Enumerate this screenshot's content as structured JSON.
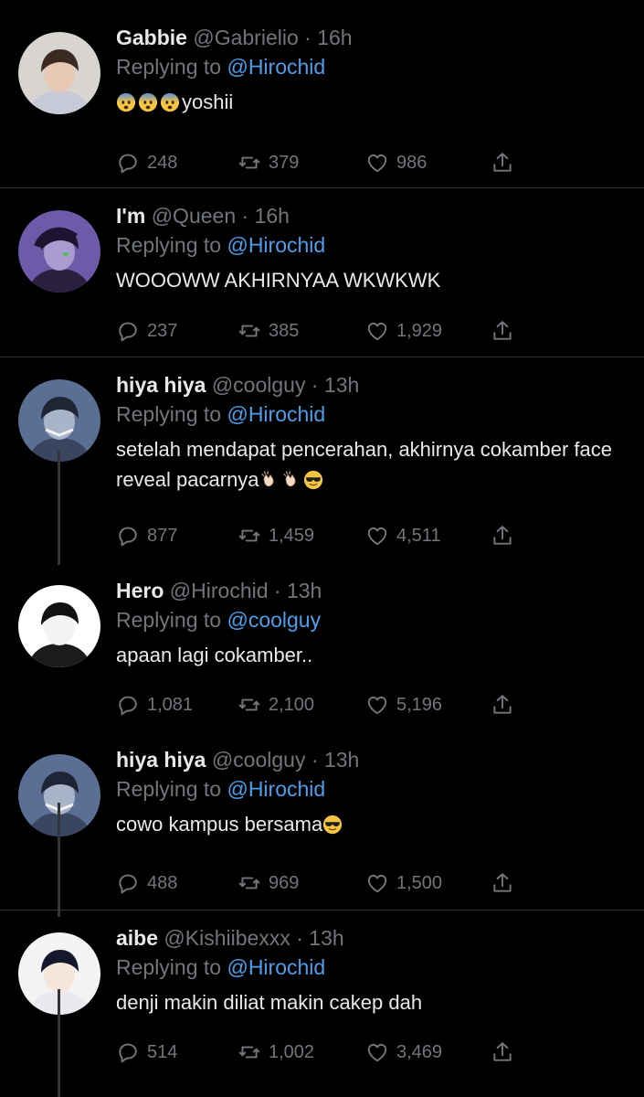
{
  "tweets": [
    {
      "name": "Gabbie",
      "handle": "@Gabrielio",
      "time": "16h",
      "replying_prefix": "Replying to ",
      "replying_to": "@Hirochid",
      "text": "yoshii",
      "emojis": [
        "fearful",
        "fearful",
        "fearful"
      ],
      "emoji_pos": "before",
      "replies": "248",
      "retweets": "379",
      "likes": "986"
    },
    {
      "name": "I'm",
      "handle": "@Queen",
      "time": "16h",
      "replying_prefix": "Replying to ",
      "replying_to": "@Hirochid",
      "text": "WOOOWW AKHIRNYAA WKWKWK",
      "emojis": [],
      "emoji_pos": "after",
      "replies": "237",
      "retweets": "385",
      "likes": "1,929"
    },
    {
      "name": "hiya hiya",
      "handle": "@coolguy",
      "time": "13h",
      "replying_prefix": "Replying to ",
      "replying_to": "@Hirochid",
      "text": "setelah mendapat pencerahan, akhirnya cokamber face reveal pacarnya",
      "emojis": [
        "clap",
        "clap",
        "sunglasses"
      ],
      "emoji_pos": "after",
      "replies": "877",
      "retweets": "1,459",
      "likes": "4,511"
    },
    {
      "name": "Hero",
      "handle": "@Hirochid",
      "time": "13h",
      "replying_prefix": "Replying to ",
      "replying_to": "@coolguy",
      "text": "apaan lagi cokamber..",
      "emojis": [],
      "emoji_pos": "after",
      "replies": "1,081",
      "retweets": "2,100",
      "likes": "5,196"
    },
    {
      "name": "hiya hiya",
      "handle": "@coolguy",
      "time": "13h",
      "replying_prefix": "Replying to ",
      "replying_to": "@Hirochid",
      "text": "cowo kampus bersama",
      "emojis": [
        "sunglasses"
      ],
      "emoji_pos": "after",
      "replies": "488",
      "retweets": "969",
      "likes": "1,500"
    },
    {
      "name": "aibe",
      "handle": "@Kishiibexxx",
      "time": "13h",
      "replying_prefix": "Replying to ",
      "replying_to": "@Hirochid",
      "text": "denji makin diliat makin cakep dah",
      "emojis": [],
      "emoji_pos": "after",
      "replies": "514",
      "retweets": "1,002",
      "likes": "3,469"
    }
  ],
  "colors": {
    "background": "#000000",
    "text": "#e7e9ea",
    "muted": "#71767b",
    "mention": "#4c9eeb",
    "divider": "#2f3336"
  },
  "icons": {
    "reply": "reply-icon",
    "retweet": "retweet-icon",
    "like": "like-icon",
    "share": "share-icon",
    "more": "more-icon"
  }
}
